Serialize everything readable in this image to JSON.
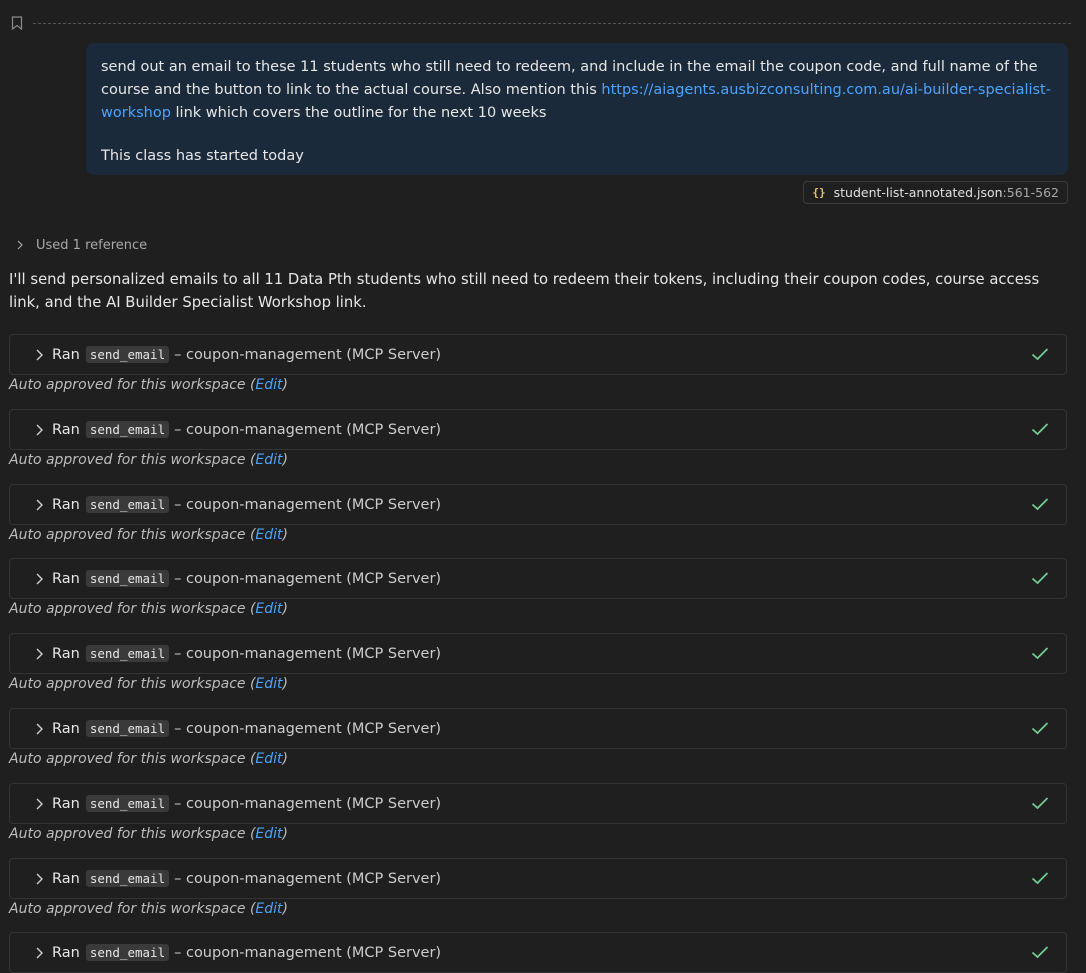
{
  "user_message": {
    "line1_prefix": "send out an email to these 11 students who still need to redeem, and include in the email the coupon code, and full name of the course and the button to link to the actual course. Also mention this ",
    "link": "https://aiagents.ausbizconsulting.com.au/ai-builder-specialist-workshop",
    "line1_suffix": " link which covers the outline for the next 10 weeks",
    "line2": "This class has started today"
  },
  "reference_chip": {
    "icon": "{}",
    "filename": "student-list-annotated.json",
    "lines": ":561-562"
  },
  "used_reference": "Used 1 reference",
  "answer": "I'll send personalized emails to all 11 Data Pth students who still need to redeem their tokens, including their coupon codes, course access link, and the AI Builder Specialist Workshop link.",
  "tool_calls": [
    {
      "ran": "Ran",
      "tool": "send_email",
      "server": "– coupon-management (MCP Server)",
      "status": "success",
      "approval": "Auto approved for this workspace (",
      "edit": "Edit",
      "approval_end": ")"
    },
    {
      "ran": "Ran",
      "tool": "send_email",
      "server": "– coupon-management (MCP Server)",
      "status": "success",
      "approval": "Auto approved for this workspace (",
      "edit": "Edit",
      "approval_end": ")"
    },
    {
      "ran": "Ran",
      "tool": "send_email",
      "server": "– coupon-management (MCP Server)",
      "status": "success",
      "approval": "Auto approved for this workspace (",
      "edit": "Edit",
      "approval_end": ")"
    },
    {
      "ran": "Ran",
      "tool": "send_email",
      "server": "– coupon-management (MCP Server)",
      "status": "success",
      "approval": "Auto approved for this workspace (",
      "edit": "Edit",
      "approval_end": ")"
    },
    {
      "ran": "Ran",
      "tool": "send_email",
      "server": "– coupon-management (MCP Server)",
      "status": "success",
      "approval": "Auto approved for this workspace (",
      "edit": "Edit",
      "approval_end": ")"
    },
    {
      "ran": "Ran",
      "tool": "send_email",
      "server": "– coupon-management (MCP Server)",
      "status": "success",
      "approval": "Auto approved for this workspace (",
      "edit": "Edit",
      "approval_end": ")"
    },
    {
      "ran": "Ran",
      "tool": "send_email",
      "server": "– coupon-management (MCP Server)",
      "status": "success",
      "approval": "Auto approved for this workspace (",
      "edit": "Edit",
      "approval_end": ")"
    },
    {
      "ran": "Ran",
      "tool": "send_email",
      "server": "– coupon-management (MCP Server)",
      "status": "success",
      "approval": "Auto approved for this workspace (",
      "edit": "Edit",
      "approval_end": ")"
    },
    {
      "ran": "Ran",
      "tool": "send_email",
      "server": "– coupon-management (MCP Server)",
      "status": "success"
    }
  ],
  "colors": {
    "background": "#1f1f1f",
    "user_bubble": "#1b2a3a",
    "link": "#4aa3ff",
    "success": "#73c991",
    "json_icon": "#e5c07b"
  }
}
